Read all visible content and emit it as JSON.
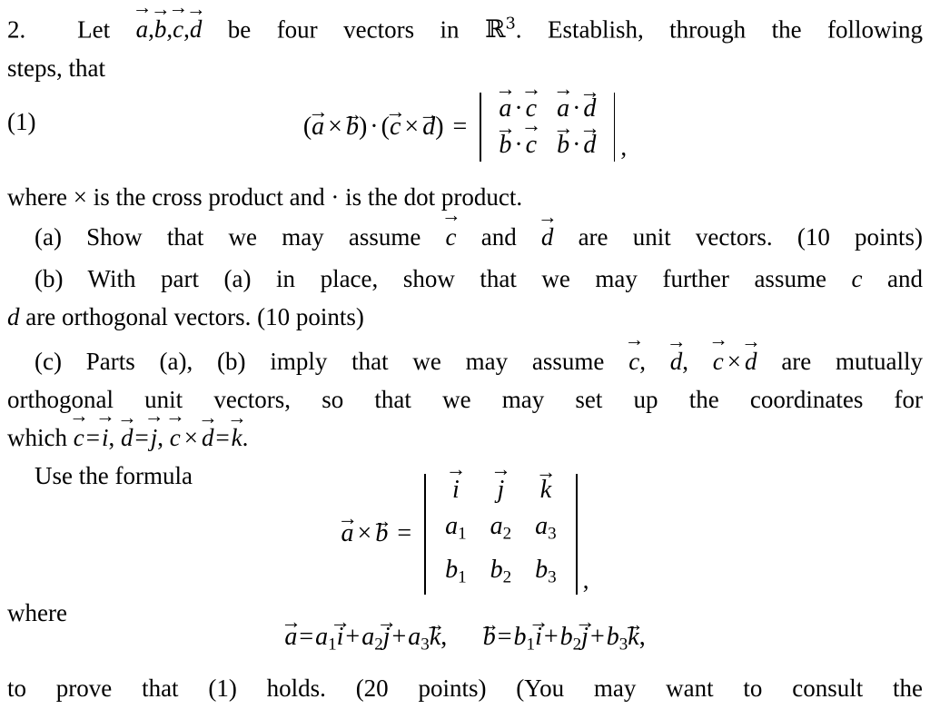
{
  "document": {
    "problem_number": "2.",
    "page_background": "#ffffff",
    "text_color": "#000000"
  },
  "intro": {
    "line1_a": "Let",
    "vectors": [
      "a",
      "b",
      "c",
      "d"
    ],
    "line1_b": "be four vectors in",
    "space": "R",
    "space_exponent": "3",
    "line1_c": ". Establish, through the following",
    "line2": "steps, that"
  },
  "equation1": {
    "number": "(1)",
    "lhs_left_open": "(",
    "lhs_v1": "a",
    "lhs_cross": "×",
    "lhs_v2": "b",
    "lhs_left_close": ")",
    "lhs_dot": "·",
    "lhs_right_open": "(",
    "lhs_v3": "c",
    "lhs_v4": "d",
    "lhs_right_close": ")",
    "equals": "=",
    "matrix": [
      [
        {
          "left": "a",
          "right": "c"
        },
        {
          "left": "a",
          "right": "d"
        }
      ],
      [
        {
          "left": "b",
          "right": "c"
        },
        {
          "left": "b",
          "right": "d"
        }
      ]
    ],
    "dot_symbol": "·",
    "trailing": ","
  },
  "where_note": {
    "part1": "where",
    "cross_symbol": "×",
    "part2": "is the cross product and",
    "dot_symbol": "·",
    "part3": "is the dot product."
  },
  "part_a": {
    "label": "(a)",
    "text1": "Show that we may assume",
    "vec1": "c",
    "text2": "and",
    "vec2": "d",
    "text3": "are unit vectors.",
    "points": "(10 points)"
  },
  "part_b": {
    "label": "(b)",
    "text1": "With part (a) in place, show that we may further assume",
    "var1": "c",
    "text2": "and",
    "line2_var": "d",
    "text3": "are orthogonal vectors.",
    "points": "(10 points)"
  },
  "part_c": {
    "label": "(c)",
    "text1": "Parts (a), (b) imply that we may assume",
    "vec1": "c",
    "comma1": ",",
    "vec2": "d",
    "comma2": ",",
    "vec3": "c",
    "cross": "×",
    "vec4": "d",
    "text2": "are mutually",
    "line2": "orthogonal unit vectors, so that we may set up the coordinates for",
    "line3_prefix": "which",
    "eq1_lhs": "c",
    "eq1_eq": "=",
    "eq1_rhs": "i",
    "eq1_comma": ",",
    "eq2_lhs": "d",
    "eq2_eq": "=",
    "eq2_rhs": "j",
    "eq2_comma": ",",
    "eq3_lhs": "c",
    "eq3_cross": "×",
    "eq3_mid": "d",
    "eq3_eq": "=",
    "eq3_rhs": "k",
    "eq3_period": "."
  },
  "use_formula": {
    "text": "Use the formula"
  },
  "equation2": {
    "lhs_v1": "a",
    "cross": "×",
    "lhs_v2": "b",
    "equals": "=",
    "matrix": [
      [
        "i",
        "j",
        "k"
      ],
      [
        "a",
        "a",
        "a"
      ],
      [
        "b",
        "b",
        "b"
      ]
    ],
    "subscripts": [
      "1",
      "2",
      "3"
    ],
    "trailing": ","
  },
  "where_label": {
    "text": "where"
  },
  "equation3": {
    "a_vec": "a",
    "a_equals": "=",
    "a_terms": [
      {
        "coef": "a",
        "sub": "1",
        "unit": "i"
      },
      {
        "coef": "a",
        "sub": "2",
        "unit": "j"
      },
      {
        "coef": "a",
        "sub": "3",
        "unit": "k"
      }
    ],
    "plus": "+",
    "a_comma": ",",
    "b_vec": "b",
    "b_equals": "=",
    "b_terms": [
      {
        "coef": "b",
        "sub": "1",
        "unit": "i"
      },
      {
        "coef": "b",
        "sub": "2",
        "unit": "j"
      },
      {
        "coef": "b",
        "sub": "3",
        "unit": "k"
      }
    ],
    "b_comma": ","
  },
  "closing": {
    "text": "to prove that (1) holds. (20 points) (You may want to consult the"
  }
}
